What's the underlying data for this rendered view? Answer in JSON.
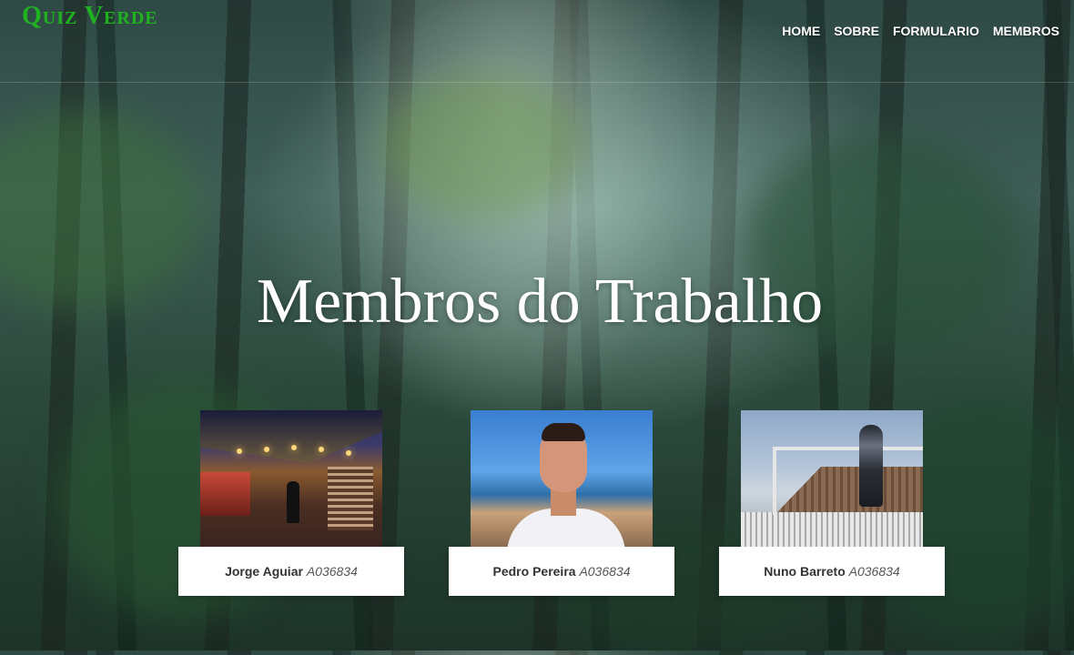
{
  "site": {
    "logo": "Quiz Verde"
  },
  "nav": {
    "items": [
      {
        "label": "HOME"
      },
      {
        "label": "SOBRE"
      },
      {
        "label": "FORMULARIO"
      },
      {
        "label": "MEMBROS"
      }
    ]
  },
  "hero": {
    "title": "Membros do Trabalho"
  },
  "members": [
    {
      "name": "Jorge Aguiar",
      "id": "A036834"
    },
    {
      "name": "Pedro Pereira",
      "id": "A036834"
    },
    {
      "name": "Nuno Barreto",
      "id": "A036834"
    }
  ],
  "colors": {
    "logo": "#1fb31f",
    "nav_text": "#ffffff",
    "caption_bg": "#ffffff"
  }
}
